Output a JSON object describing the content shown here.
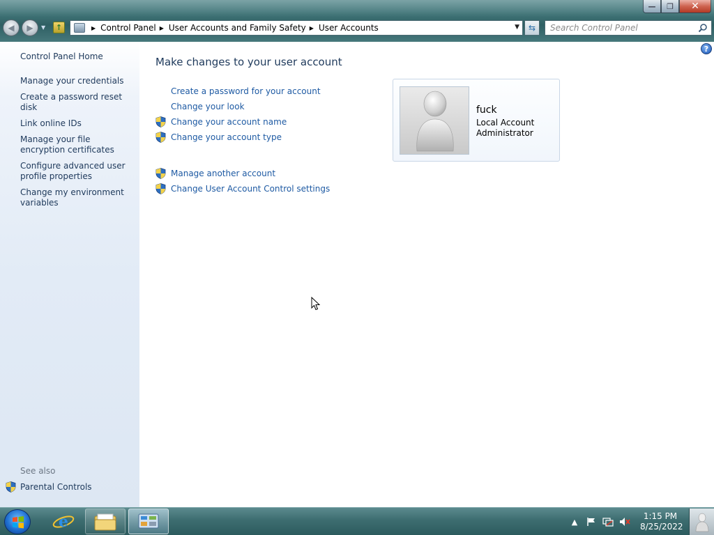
{
  "window": {
    "minimize_glyph": "—",
    "restore_glyph": "❐",
    "close_glyph": "✕"
  },
  "address": {
    "crumbs": [
      "Control Panel",
      "User Accounts and Family Safety",
      "User Accounts"
    ]
  },
  "search": {
    "placeholder": "Search Control Panel"
  },
  "sidebar": {
    "home": "Control Panel Home",
    "tasks": [
      "Manage your credentials",
      "Create a password reset disk",
      "Link online IDs",
      "Manage your file encryption certificates",
      "Configure advanced user profile properties",
      "Change my environment variables"
    ],
    "see_also_label": "See also",
    "see_also_item": "Parental Controls"
  },
  "main": {
    "title": "Make changes to your user account",
    "tasks": [
      {
        "label": "Create a password for your account",
        "shield": false
      },
      {
        "label": "Change your look",
        "shield": false
      },
      {
        "label": "Change your account name",
        "shield": true
      },
      {
        "label": "Change your account type",
        "shield": true
      }
    ],
    "other_tasks": [
      {
        "label": "Manage another account",
        "shield": true
      },
      {
        "label": "Change User Account Control settings",
        "shield": true
      }
    ]
  },
  "account": {
    "name": "fuck",
    "type": "Local Account",
    "role": "Administrator"
  },
  "taskbar": {
    "time": "1:15 PM",
    "date": "8/25/2022"
  },
  "colors": {
    "link": "#1e5aa3",
    "title": "#1e395b",
    "sidebar_bg": "#e2ebf6"
  }
}
